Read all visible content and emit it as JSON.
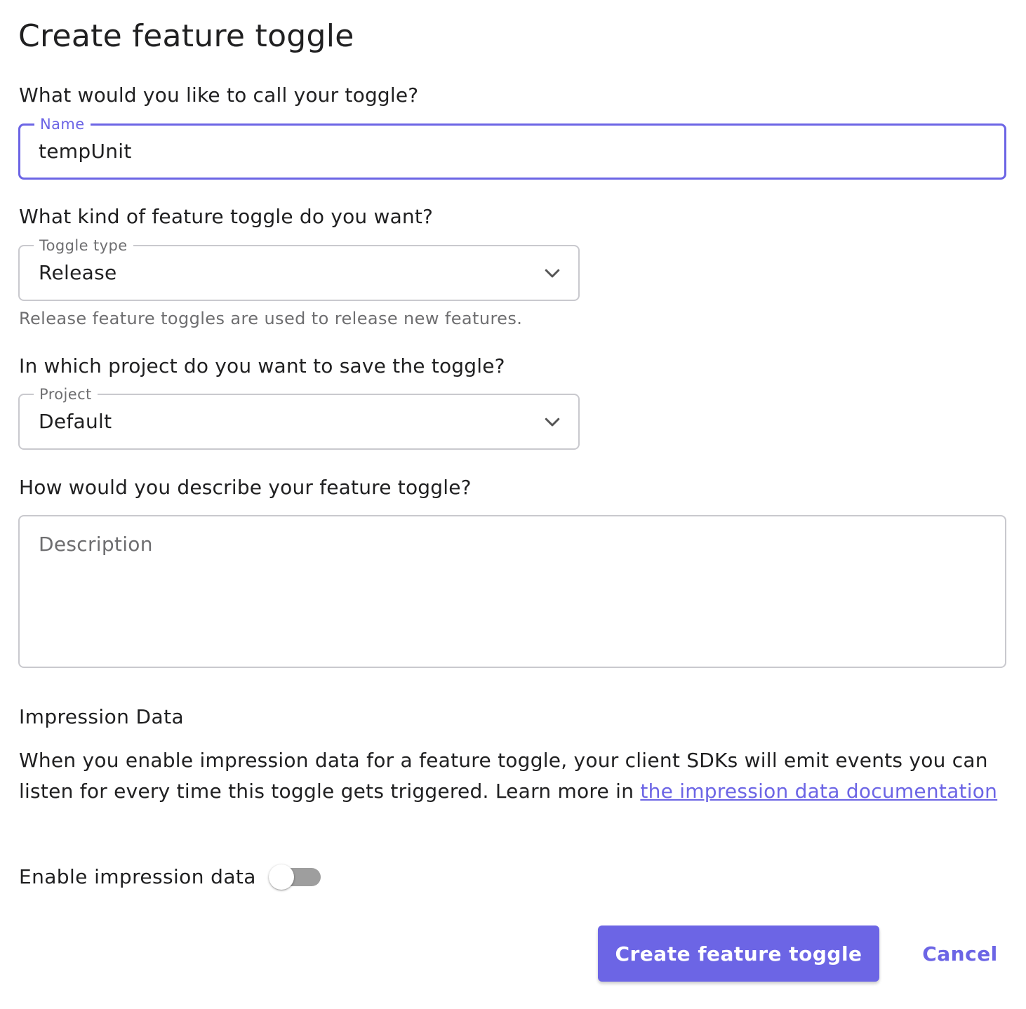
{
  "page": {
    "title": "Create feature toggle"
  },
  "name_section": {
    "question": "What would you like to call your toggle?",
    "label": "Name",
    "value": "tempUnit"
  },
  "type_section": {
    "question": "What kind of feature toggle do you want?",
    "label": "Toggle type",
    "value": "Release",
    "helper": "Release feature toggles are used to release new features."
  },
  "project_section": {
    "question": "In which project do you want to save the toggle?",
    "label": "Project",
    "value": "Default"
  },
  "description_section": {
    "question": "How would you describe your feature toggle?",
    "placeholder": "Description",
    "value": ""
  },
  "impression": {
    "title": "Impression Data",
    "text": "When you enable impression data for a feature toggle, your client SDKs will emit events you can listen for every time this toggle gets triggered. Learn more in ",
    "link_text": "the impression data documentation",
    "switch_label": "Enable impression data",
    "enabled": false
  },
  "actions": {
    "create_label": "Create feature toggle",
    "cancel_label": "Cancel"
  },
  "colors": {
    "accent": "#6c65e5",
    "border": "#c9c9ce",
    "muted_text": "#6e6e70",
    "text": "#202021",
    "switch_track_off": "#9e9e9e"
  },
  "icons": {
    "select_indicator": "chevron-down-icon"
  }
}
